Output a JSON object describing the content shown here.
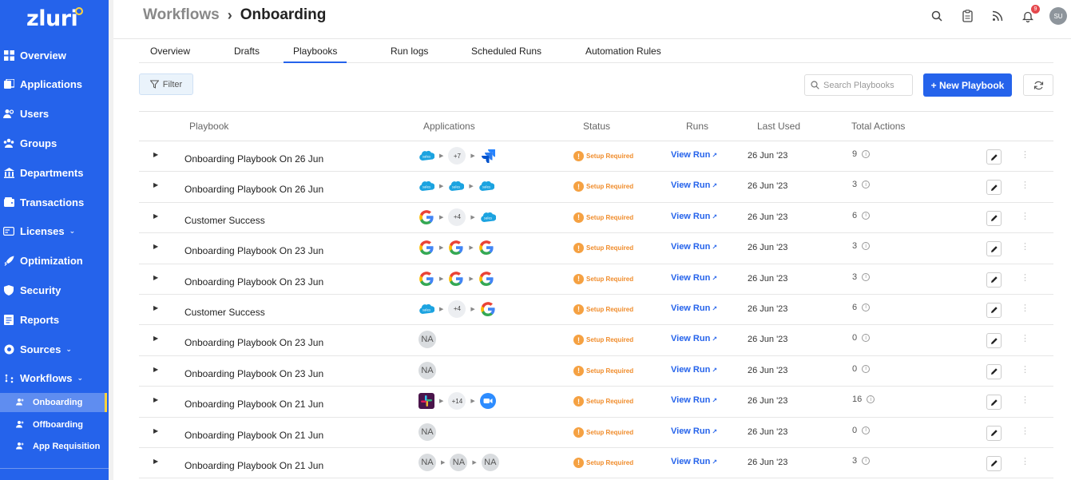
{
  "sidebar": {
    "logo": "zluri",
    "items": [
      {
        "label": "Overview",
        "icon": "grid-icon"
      },
      {
        "label": "Applications",
        "icon": "apps-icon"
      },
      {
        "label": "Users",
        "icon": "users-icon"
      },
      {
        "label": "Groups",
        "icon": "groups-icon"
      },
      {
        "label": "Departments",
        "icon": "building-icon"
      },
      {
        "label": "Transactions",
        "icon": "wallet-icon"
      },
      {
        "label": "Licenses",
        "icon": "card-icon"
      },
      {
        "label": "Optimization",
        "icon": "rocket-icon"
      },
      {
        "label": "Security",
        "icon": "shield-icon"
      },
      {
        "label": "Reports",
        "icon": "report-icon"
      },
      {
        "label": "Sources",
        "icon": "sources-icon"
      },
      {
        "label": "Workflows",
        "icon": "workflow-icon"
      }
    ],
    "sub_items": [
      {
        "label": "Onboarding",
        "active": true
      },
      {
        "label": "Offboarding",
        "active": false
      },
      {
        "label": "App Requisition",
        "active": false
      }
    ]
  },
  "header": {
    "breadcrumb_parent": "Workflows",
    "breadcrumb_current": "Onboarding",
    "notification_count": "9",
    "avatar_initials": "SU"
  },
  "tabs": [
    "Overview",
    "Drafts",
    "Playbooks",
    "Run logs",
    "Scheduled Runs",
    "Automation Rules"
  ],
  "active_tab": "Playbooks",
  "toolbar": {
    "filter_label": "Filter",
    "search_placeholder": "Search Playbooks",
    "new_button_label": "+ New Playbook"
  },
  "table": {
    "headers": [
      "Playbook",
      "Applications",
      "Status",
      "Runs",
      "Last Used",
      "Total Actions"
    ],
    "rows": [
      {
        "name": "Onboarding Playbook On 26 Jun",
        "apps": [
          "salesforce",
          "+7",
          "jira"
        ],
        "status": "Setup Required",
        "runs": "View Run",
        "last_used": "26 Jun '23",
        "total_actions": "9"
      },
      {
        "name": "Onboarding Playbook On 26 Jun",
        "apps": [
          "salesforce",
          "salesforce",
          "salesforce"
        ],
        "status": "Setup Required",
        "runs": "View Run",
        "last_used": "26 Jun '23",
        "total_actions": "3"
      },
      {
        "name": "Customer Success",
        "apps": [
          "google",
          "+4",
          "salesforce"
        ],
        "status": "Setup Required",
        "runs": "View Run",
        "last_used": "26 Jun '23",
        "total_actions": "6"
      },
      {
        "name": "Onboarding Playbook On 23 Jun",
        "apps": [
          "google",
          "google",
          "google"
        ],
        "status": "Setup Required",
        "runs": "View Run",
        "last_used": "26 Jun '23",
        "total_actions": "3"
      },
      {
        "name": "Onboarding Playbook On 23 Jun",
        "apps": [
          "google",
          "google",
          "google"
        ],
        "status": "Setup Required",
        "runs": "View Run",
        "last_used": "26 Jun '23",
        "total_actions": "3"
      },
      {
        "name": "Customer Success",
        "apps": [
          "salesforce",
          "+4",
          "google"
        ],
        "status": "Setup Required",
        "runs": "View Run",
        "last_used": "26 Jun '23",
        "total_actions": "6"
      },
      {
        "name": "Onboarding Playbook On 23 Jun",
        "apps": [
          "NA"
        ],
        "status": "Setup Required",
        "runs": "View Run",
        "last_used": "26 Jun '23",
        "total_actions": "0"
      },
      {
        "name": "Onboarding Playbook On 23 Jun",
        "apps": [
          "NA"
        ],
        "status": "Setup Required",
        "runs": "View Run",
        "last_used": "26 Jun '23",
        "total_actions": "0"
      },
      {
        "name": "Onboarding Playbook On 21 Jun",
        "apps": [
          "slack",
          "+14",
          "zoom"
        ],
        "status": "Setup Required",
        "runs": "View Run",
        "last_used": "26 Jun '23",
        "total_actions": "16"
      },
      {
        "name": "Onboarding Playbook On 21 Jun",
        "apps": [
          "NA"
        ],
        "status": "Setup Required",
        "runs": "View Run",
        "last_used": "26 Jun '23",
        "total_actions": "0"
      },
      {
        "name": "Onboarding Playbook On 21 Jun",
        "apps": [
          "NA",
          "NA",
          "NA"
        ],
        "status": "Setup Required",
        "runs": "View Run",
        "last_used": "26 Jun '23",
        "total_actions": "3"
      }
    ]
  },
  "colors": {
    "brand": "#2563eb",
    "status_warning": "#f08c2b",
    "accent": "#ffd43b"
  }
}
